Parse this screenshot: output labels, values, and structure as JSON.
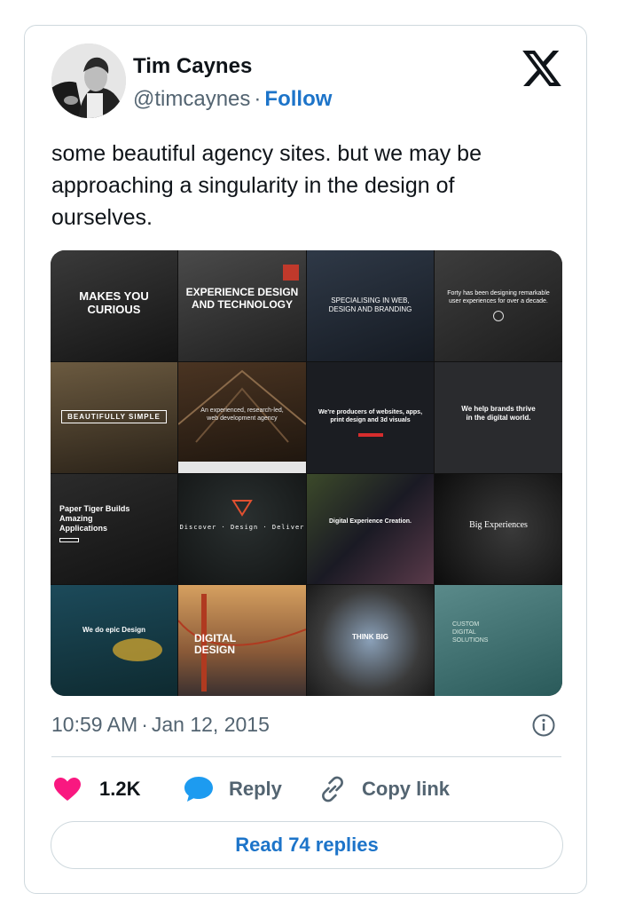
{
  "author": {
    "name": "Tim Caynes",
    "handle": "@timcaynes",
    "separator": "·",
    "follow_label": "Follow"
  },
  "brand_icon": "x-logo-icon",
  "tweet": {
    "text": "some beautiful agency sites. but we may be approaching a singularity in the design of ourselves."
  },
  "media": {
    "tiles": [
      {
        "text": "MAKES YOU CURIOUS"
      },
      {
        "text": "EXPERIENCE DESIGN AND TECHNOLOGY"
      },
      {
        "text": "SPECIALISING IN WEB, DESIGN AND BRANDING"
      },
      {
        "text": "Forty has been designing remarkable user experiences for over a decade."
      },
      {
        "text": "BEAUTIFULLY SIMPLE"
      },
      {
        "text": "An experienced, research-led, web development agency"
      },
      {
        "text": "We're producers of websites, apps, print design and 3d visuals"
      },
      {
        "text": "We help brands thrive in the digital world."
      },
      {
        "text": "Paper Tiger Builds Amazing Applications"
      },
      {
        "text": "Discover · Design · Deliver"
      },
      {
        "text": "Digital Experience Creation."
      },
      {
        "text": "Big Experiences"
      },
      {
        "text": "We do epic Design"
      },
      {
        "text": "DIGITAL DESIGN"
      },
      {
        "text": "THINK BIG"
      },
      {
        "text": "CUSTOM DIGITAL SOLUTIONS"
      }
    ]
  },
  "meta": {
    "time": "10:59 AM",
    "separator": "·",
    "date": "Jan 12, 2015"
  },
  "actions": {
    "likes": "1.2K",
    "reply_label": "Reply",
    "copy_label": "Copy link"
  },
  "read_replies_label": "Read 74 replies",
  "colors": {
    "link": "#1d74c9",
    "like": "#f91880",
    "reply_icon": "#1d9bf0",
    "muted_text": "#536471",
    "border": "#cfd9de"
  }
}
